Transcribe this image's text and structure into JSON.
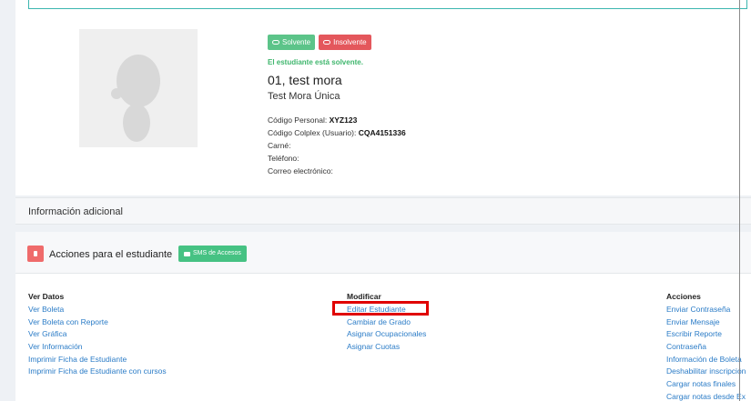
{
  "profile": {
    "badge_solvent": "Solvente",
    "badge_insolvent": "Insolvente",
    "status_message": "El estudiante está solvente.",
    "name": "01, test mora",
    "full_name": "Test Mora Única",
    "fields": [
      {
        "label": "Código Personal:",
        "value": "XYZ123"
      },
      {
        "label": "Código Colplex (Usuario):",
        "value": "CQA4151336"
      },
      {
        "label": "Carné:",
        "value": ""
      },
      {
        "label": "Teléfono:",
        "value": ""
      },
      {
        "label": "Correo electrónico:",
        "value": ""
      }
    ]
  },
  "additional_info": {
    "title": "Información adicional"
  },
  "actions": {
    "title": "Acciones para el estudiante",
    "sms_button": "SMS de Accesos",
    "columns": [
      {
        "title": "Ver Datos",
        "links": [
          "Ver Boleta",
          "Ver Boleta con Reporte",
          "Ver Gráfica",
          "Ver Información",
          "Imprimir Ficha de Estudiante",
          "Imprimir Ficha de Estudiante con cursos"
        ]
      },
      {
        "title": "Modificar",
        "links": [
          "Editar Estudiante",
          "Cambiar de Grado",
          "Asignar Ocupacionales",
          "Asignar Cuotas"
        ]
      },
      {
        "title": "Acciones",
        "links": [
          "Enviar Contraseña",
          "Enviar Mensaje",
          "Escribir Reporte",
          "Contraseña",
          "Información de Boleta",
          "Deshabilitar inscripción",
          "Cargar notas finales",
          "Cargar notas desde Ex"
        ]
      }
    ]
  }
}
